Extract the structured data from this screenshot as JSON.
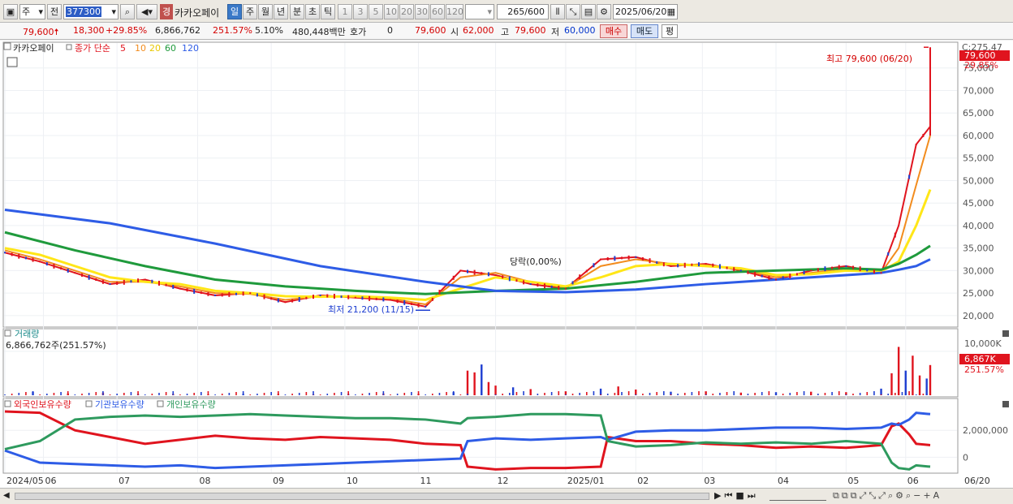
{
  "toolbar": {
    "type_select": "주",
    "prev_label": "전",
    "code_value": "377300",
    "caution_badge": "경",
    "stock_name": "카카오페이",
    "periods": [
      "일",
      "주",
      "월",
      "년",
      "분",
      "초",
      "틱"
    ],
    "active_period": "일",
    "tick_options": [
      "1",
      "3",
      "5",
      "10",
      "20",
      "30",
      "60",
      "120"
    ],
    "count_value": "265",
    "count_total": "/600",
    "date_value": "2025/06/20"
  },
  "quote": {
    "price": "79,600",
    "change": "18,300",
    "change_rate": "+29.85%",
    "volume": "6,866,762",
    "volume_rate": "251.57%",
    "turnover": "5.10%",
    "amount": "480,448백만",
    "hoga_label": "호가",
    "hoga_value": "0",
    "hoga_price": "79,600",
    "open_label": "시",
    "open": "62,000",
    "high_label": "고",
    "high": "79,600",
    "low_label": "저",
    "low": "60,000",
    "buy_label": "매수",
    "sell_label": "매도",
    "avg_label": "평"
  },
  "colors": {
    "up": "#e0141e",
    "down": "#1f3fd1",
    "ma5": "#e0141e",
    "ma10": "#f28c1e",
    "ma20": "#ffe617",
    "ma60": "#1f9a3c",
    "ma120": "#2e5ce6",
    "foreign": "#e0141e",
    "institution": "#2e5ce6",
    "individual": "#2e9a5e"
  },
  "chart_data": [
    {
      "type": "line",
      "title": "카카오페이",
      "legend": [
        "종가 단순",
        "5",
        "10",
        "20",
        "60",
        "120"
      ],
      "price_top_label": "C:275.47",
      "y_ticks": [
        75000,
        70000,
        65000,
        60000,
        55000,
        50000,
        45000,
        40000,
        35000,
        30000,
        25000,
        20000
      ],
      "y_tick_labels": [
        "75,000",
        "70,000",
        "65,000",
        "60,000",
        "55,000",
        "50,000",
        "45,000",
        "40,000",
        "35,000",
        "30,000",
        "25,000",
        "20,000"
      ],
      "ylim": [
        18000,
        80000
      ],
      "x_labels": [
        "2024/05",
        "06",
        "07",
        "08",
        "09",
        "10",
        "11",
        "12",
        "2025/01",
        "02",
        "03",
        "04",
        "05",
        "06",
        "06/20"
      ],
      "current_price_label": "79,600",
      "current_rate_label": "29.85%",
      "annotations": {
        "high": "최고 79,600 (06/20)",
        "low": "최저 21,200 (11/15)",
        "event": "당락(0,00%)"
      },
      "series": [
        {
          "name": "5",
          "x": [
            0,
            10,
            20,
            30,
            40,
            50,
            60,
            70,
            80,
            90,
            100,
            110,
            120,
            130,
            140,
            150,
            160,
            170,
            180,
            190,
            200,
            210,
            220,
            230,
            240,
            250,
            255,
            260,
            264
          ],
          "values": [
            34000,
            32000,
            29500,
            27000,
            28000,
            26000,
            24500,
            25000,
            23000,
            24500,
            24000,
            23500,
            22000,
            30000,
            29000,
            27000,
            26000,
            32500,
            33000,
            31000,
            31500,
            30000,
            28000,
            30000,
            31000,
            29500,
            40000,
            58000,
            62000
          ]
        },
        {
          "name": "10",
          "x": [
            0,
            10,
            20,
            30,
            40,
            50,
            60,
            70,
            80,
            90,
            100,
            110,
            120,
            130,
            140,
            150,
            160,
            170,
            180,
            190,
            200,
            210,
            220,
            230,
            240,
            250,
            255,
            260,
            264
          ],
          "values": [
            34500,
            32500,
            30000,
            27500,
            27500,
            26500,
            25000,
            24800,
            23500,
            24300,
            24200,
            23800,
            22500,
            28500,
            29500,
            27500,
            26200,
            31000,
            32500,
            31500,
            31200,
            30200,
            28500,
            29500,
            30500,
            29500,
            35000,
            49000,
            60000
          ]
        },
        {
          "name": "20",
          "x": [
            0,
            10,
            20,
            30,
            40,
            50,
            60,
            70,
            80,
            90,
            100,
            110,
            120,
            130,
            140,
            150,
            160,
            170,
            180,
            190,
            200,
            210,
            220,
            230,
            240,
            250,
            255,
            260,
            264
          ],
          "values": [
            35000,
            33500,
            31000,
            28500,
            27500,
            27000,
            25500,
            25000,
            24300,
            24200,
            24300,
            24000,
            23500,
            26000,
            28500,
            27500,
            26500,
            28500,
            31000,
            31500,
            31000,
            30500,
            29000,
            29200,
            30000,
            29800,
            32000,
            40000,
            48000
          ]
        },
        {
          "name": "60",
          "x": [
            0,
            20,
            40,
            60,
            80,
            100,
            120,
            140,
            160,
            180,
            200,
            220,
            240,
            250,
            255,
            260,
            264
          ],
          "values": [
            38500,
            34500,
            31000,
            28000,
            26500,
            25500,
            24800,
            25500,
            26000,
            27500,
            29500,
            30000,
            30500,
            30200,
            31500,
            33500,
            35500
          ]
        },
        {
          "name": "120",
          "x": [
            0,
            30,
            60,
            90,
            120,
            140,
            160,
            180,
            200,
            220,
            240,
            250,
            255,
            260,
            264
          ],
          "values": [
            43500,
            40500,
            36000,
            31000,
            27500,
            25500,
            25200,
            25800,
            27000,
            28000,
            29000,
            29500,
            30200,
            31000,
            32500
          ]
        }
      ]
    },
    {
      "type": "bar",
      "title": "거래량",
      "value_label": "6,866,762주(251.57%)",
      "y_tick_label": "10,000K",
      "current_label": "6,867K",
      "current_rate_label": "251.57%",
      "x": [
        8,
        18,
        28,
        38,
        48,
        58,
        68,
        78,
        88,
        98,
        108,
        118,
        128,
        132,
        134,
        136,
        138,
        140,
        145,
        150,
        160,
        170,
        175,
        180,
        190,
        200,
        210,
        220,
        230,
        240,
        250,
        253,
        255,
        257,
        259,
        261,
        263,
        264
      ],
      "values": [
        800,
        400,
        600,
        300,
        300,
        200,
        300,
        300,
        200,
        300,
        400,
        300,
        700,
        5600,
        5200,
        7000,
        3000,
        2200,
        1800,
        1400,
        900,
        1500,
        2000,
        1300,
        800,
        900,
        600,
        700,
        800,
        700,
        1500,
        5000,
        11000,
        5600,
        9000,
        4500,
        3800,
        6867
      ]
    },
    {
      "type": "line",
      "title": "외국인보유수량 · 기관보유수량 · 개인보유수량",
      "legend": [
        "외국인보유수량",
        "기관보유수량",
        "개인보유수량"
      ],
      "y_ticks": [
        2000000,
        0
      ],
      "y_tick_labels": [
        "2,000,000",
        "0"
      ],
      "ylim": [
        -1000000,
        3700000
      ],
      "series": [
        {
          "name": "외국인보유수량",
          "x": [
            0,
            10,
            20,
            30,
            40,
            50,
            60,
            70,
            80,
            90,
            100,
            110,
            120,
            130,
            132,
            140,
            150,
            160,
            170,
            172,
            180,
            190,
            200,
            210,
            220,
            230,
            240,
            250,
            253,
            255,
            258,
            260,
            264
          ],
          "values": [
            3400000,
            3300000,
            2000000,
            1500000,
            1000000,
            1300000,
            1600000,
            1400000,
            1300000,
            1500000,
            1400000,
            1300000,
            1000000,
            900000,
            -700000,
            -900000,
            -800000,
            -800000,
            -700000,
            1500000,
            1200000,
            1200000,
            1000000,
            900000,
            700000,
            800000,
            700000,
            900000,
            2300000,
            2500000,
            1700000,
            1000000,
            900000
          ]
        },
        {
          "name": "기관보유수량",
          "x": [
            0,
            10,
            20,
            30,
            40,
            50,
            60,
            70,
            80,
            90,
            100,
            110,
            120,
            130,
            132,
            140,
            150,
            160,
            170,
            172,
            180,
            190,
            200,
            210,
            220,
            230,
            240,
            250,
            253,
            255,
            258,
            260,
            264
          ],
          "values": [
            500000,
            -400000,
            -500000,
            -600000,
            -700000,
            -600000,
            -800000,
            -700000,
            -600000,
            -500000,
            -400000,
            -300000,
            -200000,
            -100000,
            1200000,
            1400000,
            1300000,
            1400000,
            1500000,
            1300000,
            1900000,
            2000000,
            2000000,
            2100000,
            2200000,
            2200000,
            2100000,
            2200000,
            2500000,
            2400000,
            2800000,
            3300000,
            3200000
          ]
        },
        {
          "name": "개인보유수량",
          "x": [
            0,
            10,
            20,
            30,
            40,
            50,
            60,
            70,
            80,
            90,
            100,
            110,
            120,
            130,
            132,
            140,
            150,
            160,
            170,
            172,
            180,
            190,
            200,
            210,
            220,
            230,
            240,
            250,
            253,
            255,
            258,
            260,
            264
          ],
          "values": [
            600000,
            1200000,
            2800000,
            3000000,
            3100000,
            3000000,
            3100000,
            3200000,
            3100000,
            3000000,
            2900000,
            2900000,
            2800000,
            2500000,
            2900000,
            3000000,
            3200000,
            3200000,
            3100000,
            1200000,
            800000,
            900000,
            1100000,
            1000000,
            1100000,
            1000000,
            1200000,
            1000000,
            -400000,
            -800000,
            -900000,
            -600000,
            -700000
          ]
        }
      ]
    }
  ],
  "status": {
    "hint": ""
  }
}
